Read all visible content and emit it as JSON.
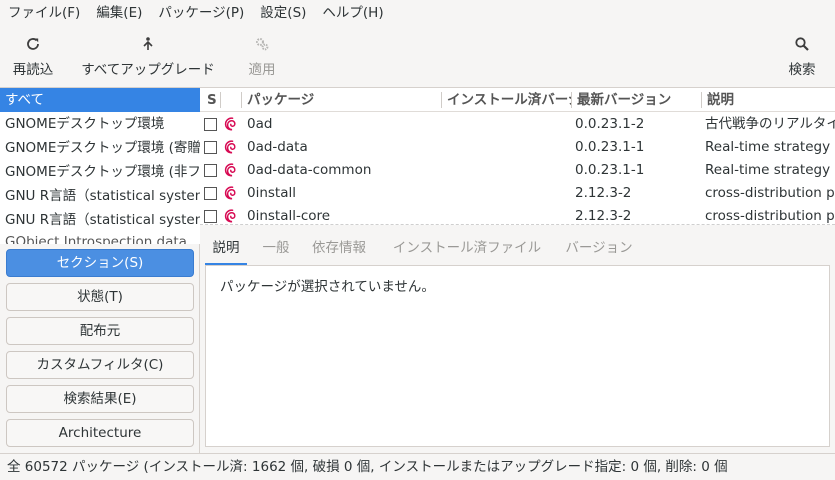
{
  "menubar": {
    "items": [
      "ファイル(F)",
      "編集(E)",
      "パッケージ(P)",
      "設定(S)",
      "ヘルプ(H)"
    ]
  },
  "toolbar": {
    "reload": {
      "label": "再読込",
      "icon": "reload-icon"
    },
    "upgrade_all": {
      "label": "すべてアップグレード",
      "icon": "upgrade-icon"
    },
    "apply": {
      "label": "適用",
      "icon": "apply-gears-icon"
    },
    "search": {
      "label": "検索",
      "icon": "search-icon"
    }
  },
  "filters": {
    "items": [
      {
        "label": "すべて",
        "selected": true
      },
      {
        "label": "GNOMEデスクトップ環境",
        "selected": false
      },
      {
        "label": "GNOMEデスクトップ環境 (寄贈)",
        "selected": false
      },
      {
        "label": "GNOMEデスクトップ環境 (非フリー)",
        "selected": false
      },
      {
        "label": "GNU R言語（statistical system）",
        "selected": false
      },
      {
        "label": "GNU R言語（statistical system）",
        "selected": false
      }
    ],
    "partial_item": "GObject Introspection data"
  },
  "filter_buttons": {
    "sections": "セクション(S)",
    "status": "状態(T)",
    "origin": "配布元",
    "custom": "カスタムフィルタ(C)",
    "search_results": "検索結果(E)",
    "architecture": "Architecture"
  },
  "table": {
    "headers": {
      "s": "S",
      "package": "パッケージ",
      "installed": "インストール済バージョン",
      "latest": "最新バージョン",
      "description": "説明"
    },
    "rows": [
      {
        "name": "0ad",
        "installed": "",
        "latest": "0.0.23.1-2",
        "description": "古代戦争のリアルタイムストラテジーゲーム"
      },
      {
        "name": "0ad-data",
        "installed": "",
        "latest": "0.0.23.1-1",
        "description": "Real-time strategy game of ancient warfare"
      },
      {
        "name": "0ad-data-common",
        "installed": "",
        "latest": "0.0.23.1-1",
        "description": "Real-time strategy game of ancient warfare"
      },
      {
        "name": "0install",
        "installed": "",
        "latest": "2.12.3-2",
        "description": "cross-distribution packaging system"
      },
      {
        "name": "0install-core",
        "installed": "",
        "latest": "2.12.3-2",
        "description": "cross-distribution packaging system"
      }
    ]
  },
  "details": {
    "tabs": [
      "説明",
      "一般",
      "依存情報",
      "インストール済ファイル",
      "バージョン"
    ],
    "active_tab": 0,
    "message": "パッケージが選択されていません。"
  },
  "status": {
    "text": "全 60572 パッケージ (インストール済: 1662 個, 破損 0 個, インストールまたはアップグレード指定: 0 個, 削除: 0 個"
  },
  "colors": {
    "accent": "#3584e4",
    "debian_swirl": "#d70a53"
  }
}
